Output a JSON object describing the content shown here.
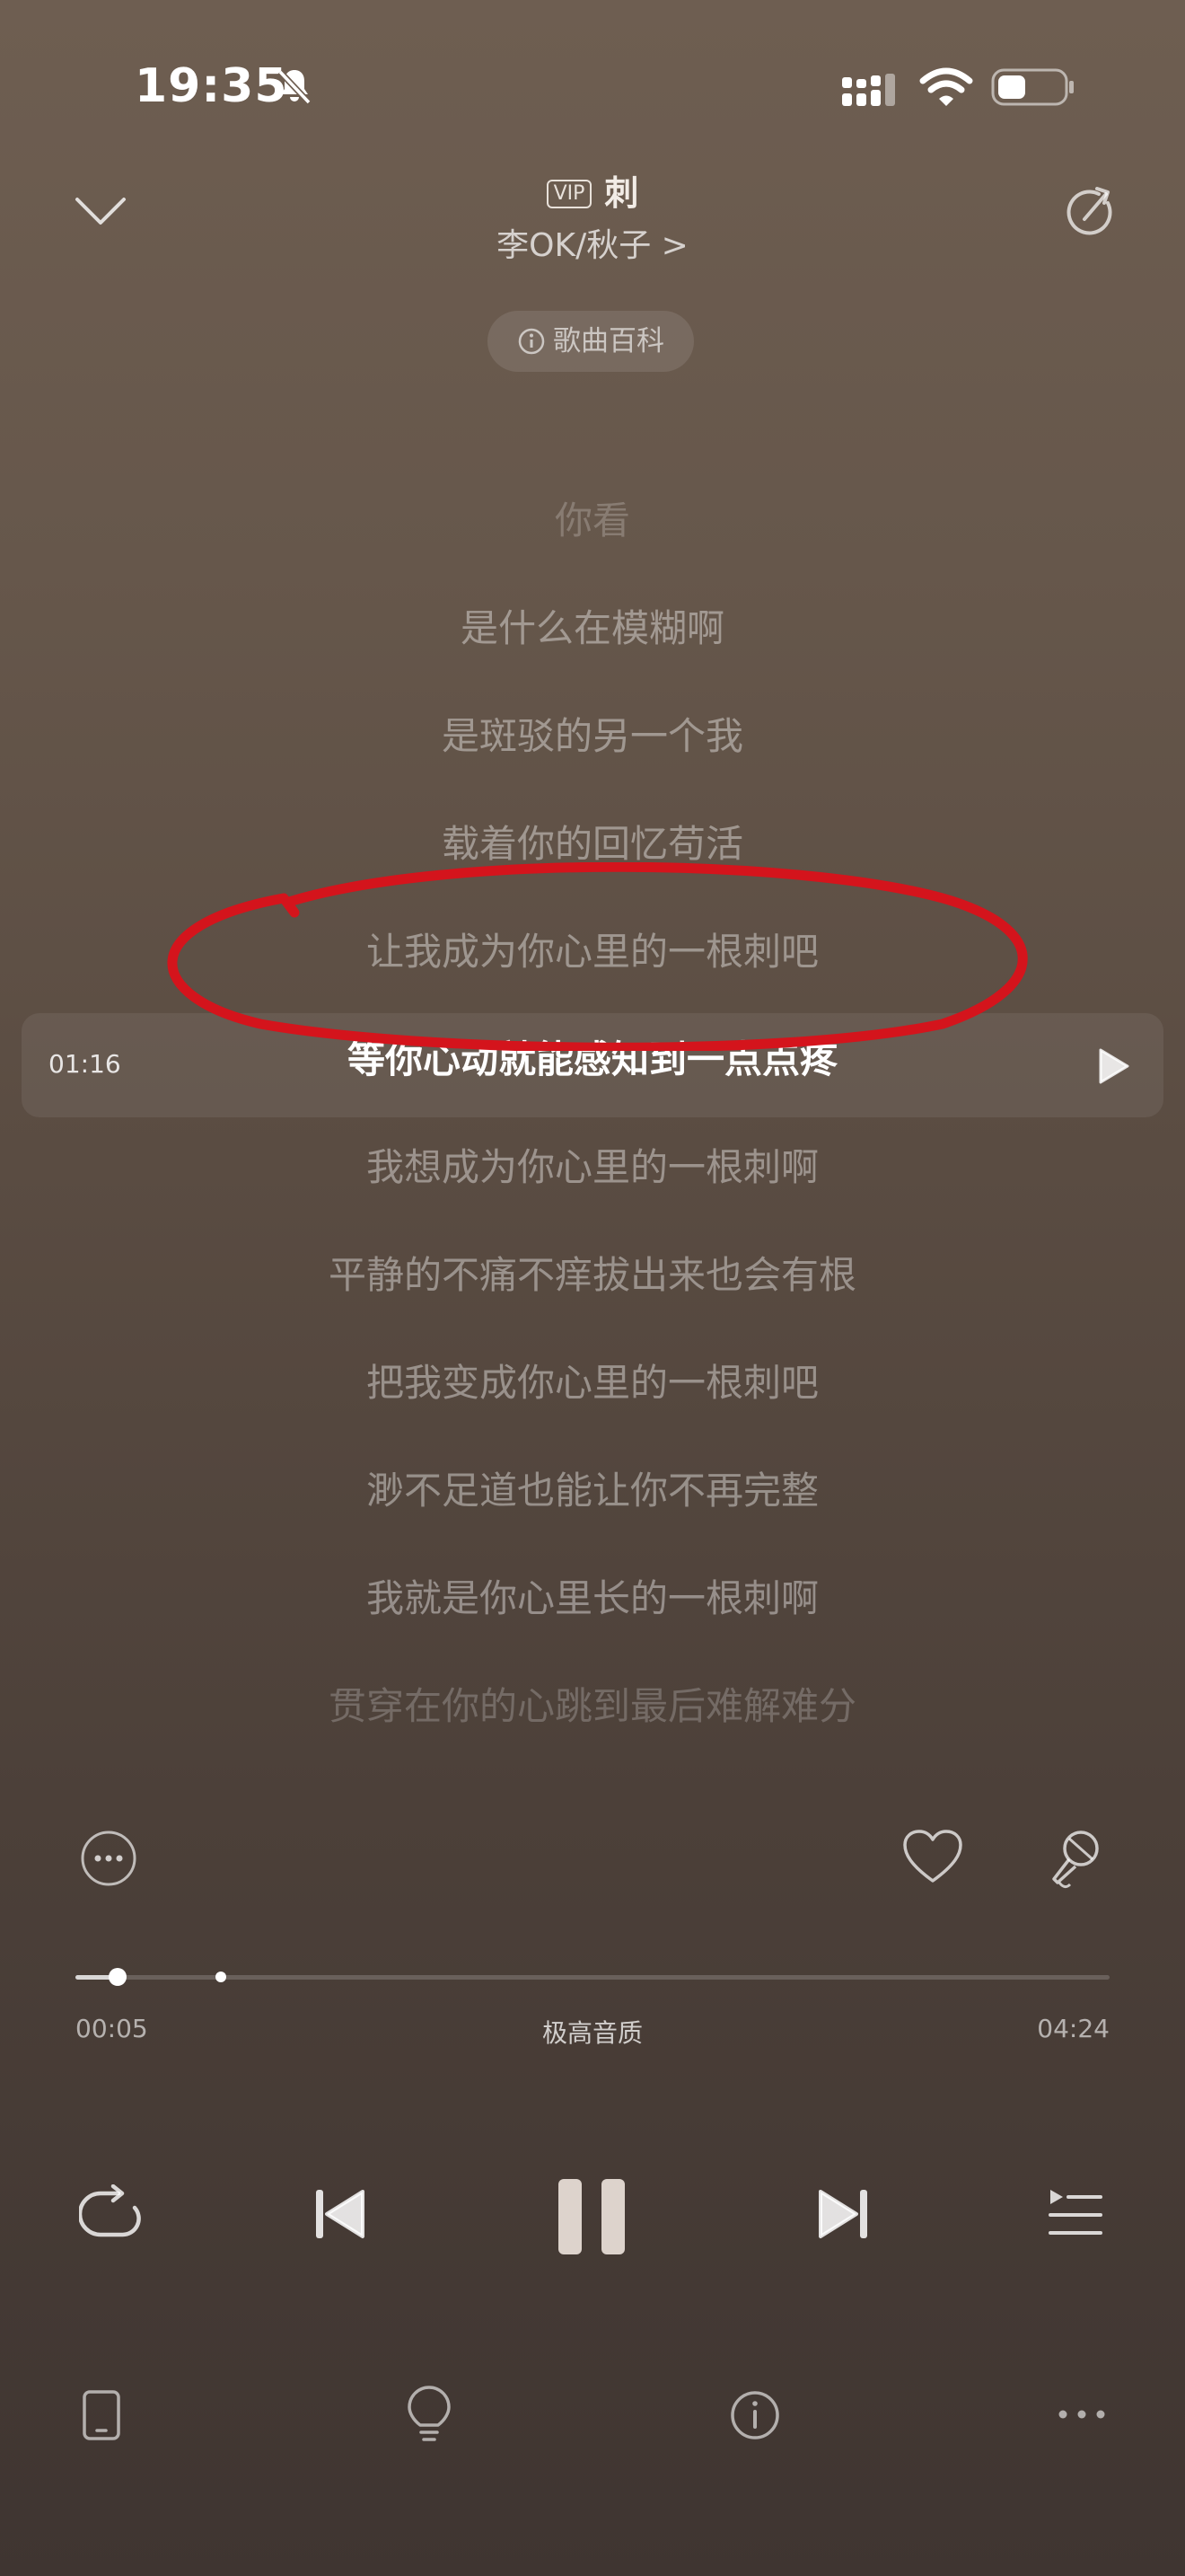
{
  "status_bar": {
    "time": "19:35",
    "icons": [
      "bell-slash-icon",
      "signal-icon",
      "wifi-icon",
      "battery-icon"
    ]
  },
  "header": {
    "vip_badge": "VIP",
    "song_title": "刺",
    "artist": "李OK/秋子 >",
    "wiki_button": "歌曲百科"
  },
  "lyrics": {
    "lines": [
      {
        "text": "你看",
        "state": "faded"
      },
      {
        "text": "是什么在模糊啊",
        "state": "inactive"
      },
      {
        "text": "是斑驳的另一个我",
        "state": "inactive"
      },
      {
        "text": "载着你的回忆苟活",
        "state": "inactive"
      },
      {
        "text": "让我成为你心里的一根刺吧",
        "state": "inactive"
      },
      {
        "text": "等你心动就能感知到一点点疼",
        "state": "active"
      },
      {
        "text": "我想成为你心里的一根刺啊",
        "state": "inactive"
      },
      {
        "text": "平静的不痛不痒拔出来也会有根",
        "state": "inactive"
      },
      {
        "text": "把我变成你心里的一根刺吧",
        "state": "inactive"
      },
      {
        "text": "渺不足道也能让你不再完整",
        "state": "inactive"
      },
      {
        "text": "我就是你心里长的一根刺啊",
        "state": "inactive"
      },
      {
        "text": "贯穿在你的心跳到最后难解难分",
        "state": "faded"
      }
    ],
    "active_timestamp": "01:16"
  },
  "player": {
    "current_time": "00:05",
    "total_time": "04:24",
    "quality_label": "极高音质",
    "progress_fraction": 0.019,
    "buffered_fraction": 0.08
  },
  "colors": {
    "annotation": "#d4141c",
    "background_top": "#6e5e51",
    "background_bottom": "#3f3531"
  }
}
